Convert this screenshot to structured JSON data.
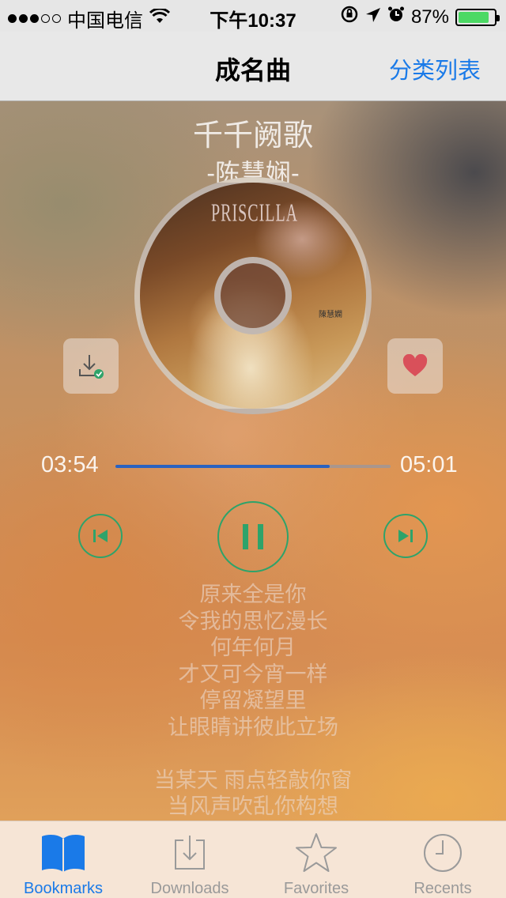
{
  "status_bar": {
    "carrier": "中国电信",
    "signal_dots_filled": 3,
    "signal_dots_total": 5,
    "time": "下午10:37",
    "battery_percent": "87%",
    "battery_level": 0.87,
    "icons": [
      "wifi-icon",
      "rotation-lock-icon",
      "location-arrow-icon",
      "alarm-icon",
      "battery-icon"
    ]
  },
  "nav": {
    "title": "成名曲",
    "right_button": "分类列表"
  },
  "player": {
    "song_title": "千千阙歌",
    "artist": "-陈慧娴-",
    "cover_text": "PRISCILLA",
    "cover_small_text": "陳慧嫻",
    "current_time": "03:54",
    "total_time": "05:01",
    "progress": 0.779,
    "download_icon": "download-icon",
    "like_icon": "heart-icon",
    "accent_color": "#2ea36a",
    "progress_color": "#2a62c0",
    "like_color": "#d9505a"
  },
  "lyrics": {
    "lines": [
      "原来全是你",
      "令我的思忆漫长",
      "何年何月",
      "才又可今宵一样",
      "停留凝望里",
      "让眼睛讲彼此立场",
      "",
      "当某天 雨点轻敲你窗",
      "当风声吹乱你构想"
    ]
  },
  "tab_bar": {
    "tabs": [
      {
        "label": "Bookmarks",
        "icon": "bookmarks-icon",
        "active": true
      },
      {
        "label": "Downloads",
        "icon": "downloads-icon",
        "active": false
      },
      {
        "label": "Favorites",
        "icon": "star-icon",
        "active": false
      },
      {
        "label": "Recents",
        "icon": "clock-icon",
        "active": false
      }
    ],
    "active_color": "#1a7ae8",
    "inactive_color": "#9a9a9a"
  }
}
